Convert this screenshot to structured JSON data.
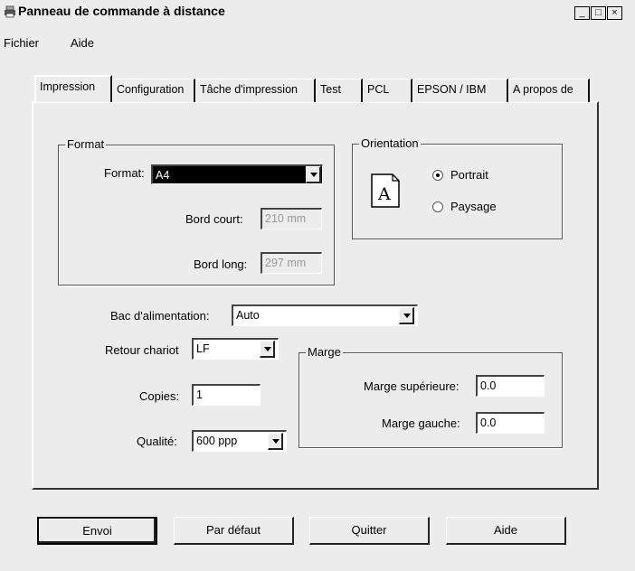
{
  "window": {
    "title": "Panneau de commande à distance",
    "minimize": "_",
    "maximize": "□",
    "close": "×"
  },
  "menu": [
    "Fichier",
    "Aide"
  ],
  "tabs": [
    "Impression",
    "Configuration",
    "Tâche d'impression",
    "Test",
    "PCL",
    "EPSON / IBM",
    "A propos de"
  ],
  "format_group": {
    "legend": "Format",
    "format_label": "Format:",
    "format_value": "A4",
    "short_edge_label": "Bord court:",
    "short_edge_value": "210 mm",
    "long_edge_label": "Bord long:",
    "long_edge_value": "297 mm"
  },
  "orientation_group": {
    "legend": "Orientation",
    "icon_letter": "A",
    "portrait": "Portrait",
    "landscape": "Paysage",
    "selected": "Portrait"
  },
  "tray": {
    "label": "Bac d'alimentation:",
    "value": "Auto"
  },
  "line_feed": {
    "label": "Retour chariot",
    "value": "LF"
  },
  "copies": {
    "label": "Copies:",
    "value": "1"
  },
  "quality": {
    "label": "Qualité:",
    "value": "600 ppp"
  },
  "margin_group": {
    "legend": "Marge",
    "top_label": "Marge supérieure:",
    "top_value": "0.0",
    "left_label": "Marge gauche:",
    "left_value": "0.0"
  },
  "buttons": {
    "send": "Envoi",
    "default": "Par défaut",
    "quit": "Quitter",
    "help": "Aide"
  }
}
